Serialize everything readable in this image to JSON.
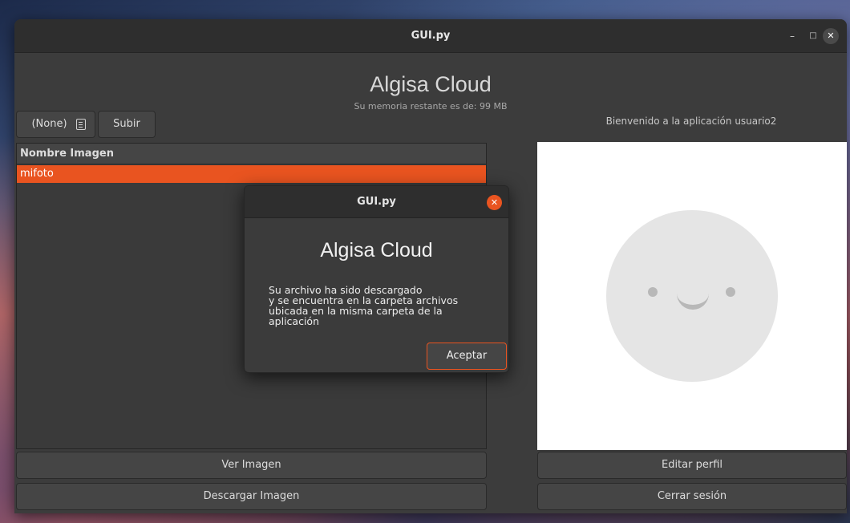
{
  "window": {
    "title": "GUI.py",
    "controls": {
      "minimize": "–",
      "maximize": "□",
      "close": "✕"
    }
  },
  "app": {
    "title": "Algisa Cloud",
    "memory_text": "Su memoria restante es de: 99 MB",
    "welcome_text": "Bienvenido a la aplicación usuario2"
  },
  "toolbar": {
    "combo_value": "(None)",
    "upload_label": "Subir"
  },
  "list": {
    "header": "Nombre Imagen",
    "rows": [
      "mifoto"
    ]
  },
  "buttons": {
    "view_image": "Ver Imagen",
    "download_image": "Descargar Imagen",
    "edit_profile": "Editar perfil",
    "logout": "Cerrar sesión"
  },
  "dialog": {
    "title": "GUI.py",
    "close": "✕",
    "heading": "Algisa Cloud",
    "message": "Su archivo ha sido descargado\n y se encuentra en la carpeta archivos\nubicada en la misma carpeta de la\naplicación",
    "accept_label": "Aceptar"
  },
  "colors": {
    "accent": "#e95420",
    "window_bg": "#3c3c3c",
    "titlebar_bg": "#2e2e2e"
  },
  "icons": {
    "combo_icon": "file-list-icon",
    "avatar": "smiley-avatar-icon"
  }
}
